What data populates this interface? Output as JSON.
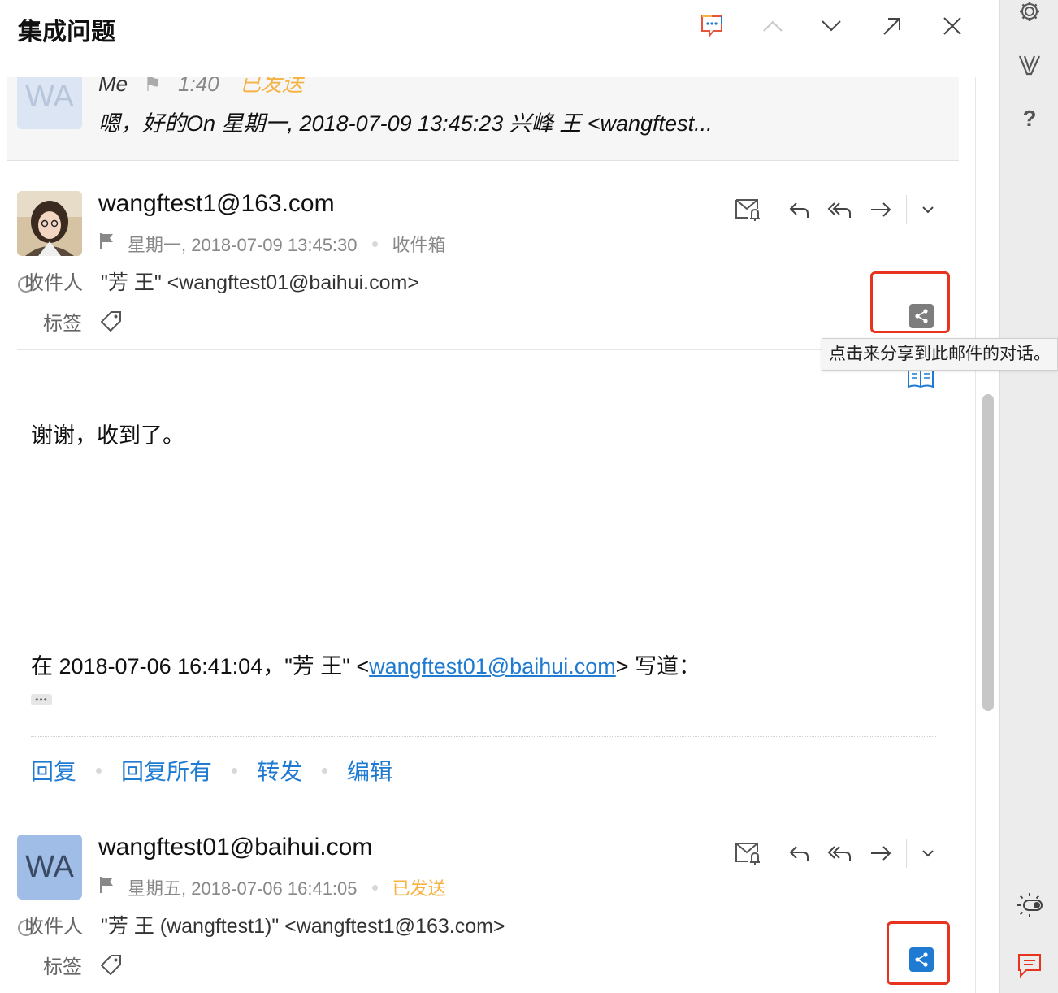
{
  "header": {
    "title": "集成问题",
    "icons": [
      "chat-bubble-icon",
      "chevron-up-icon",
      "chevron-down-icon",
      "pop-out-icon",
      "close-icon"
    ]
  },
  "right_sidebar": {
    "icons": [
      "gear-icon",
      "brand-v-icon",
      "help-icon",
      "theme-toggle-icon",
      "feedback-icon"
    ],
    "help_label": "?"
  },
  "collapsed_message": {
    "avatar_initials": "WA",
    "sender": "Me",
    "time": "1:40",
    "status": "已发送",
    "preview": "嗯，好的On 星期一, 2018-07-09 13:45:23 兴峰 王 <wangftest..."
  },
  "message1": {
    "sender": "wangftest1@163.com",
    "date": "星期一, 2018-07-09 13:45:30",
    "folder": "收件箱",
    "to_label": "收件人",
    "to_value": "\"芳 王\" <wangftest01@baihui.com>",
    "tags_label": "标签",
    "tooltip": "点击来分享到此邮件的对话。",
    "body": "谢谢，收到了。",
    "quote_prefix": "在 2018-07-06 16:41:04，\"芳 王\" <",
    "quote_link": "wangftest01@baihui.com",
    "quote_suffix": "> 写道：",
    "ellipsis": "•••",
    "quick_actions": {
      "reply": "回复",
      "reply_all": "回复所有",
      "forward": "转发",
      "edit": "编辑"
    }
  },
  "message2": {
    "avatar_initials": "WA",
    "sender": "wangftest01@baihui.com",
    "date": "星期五, 2018-07-06 16:41:05",
    "folder": "已发送",
    "to_label": "收件人",
    "to_value": "\"芳 王 (wangftest1)\" <wangftest1@163.com>",
    "tags_label": "标签"
  },
  "colors": {
    "accent_blue": "#1e7bd1",
    "sent_orange": "#f6b242",
    "highlight_red": "#e8331e"
  }
}
